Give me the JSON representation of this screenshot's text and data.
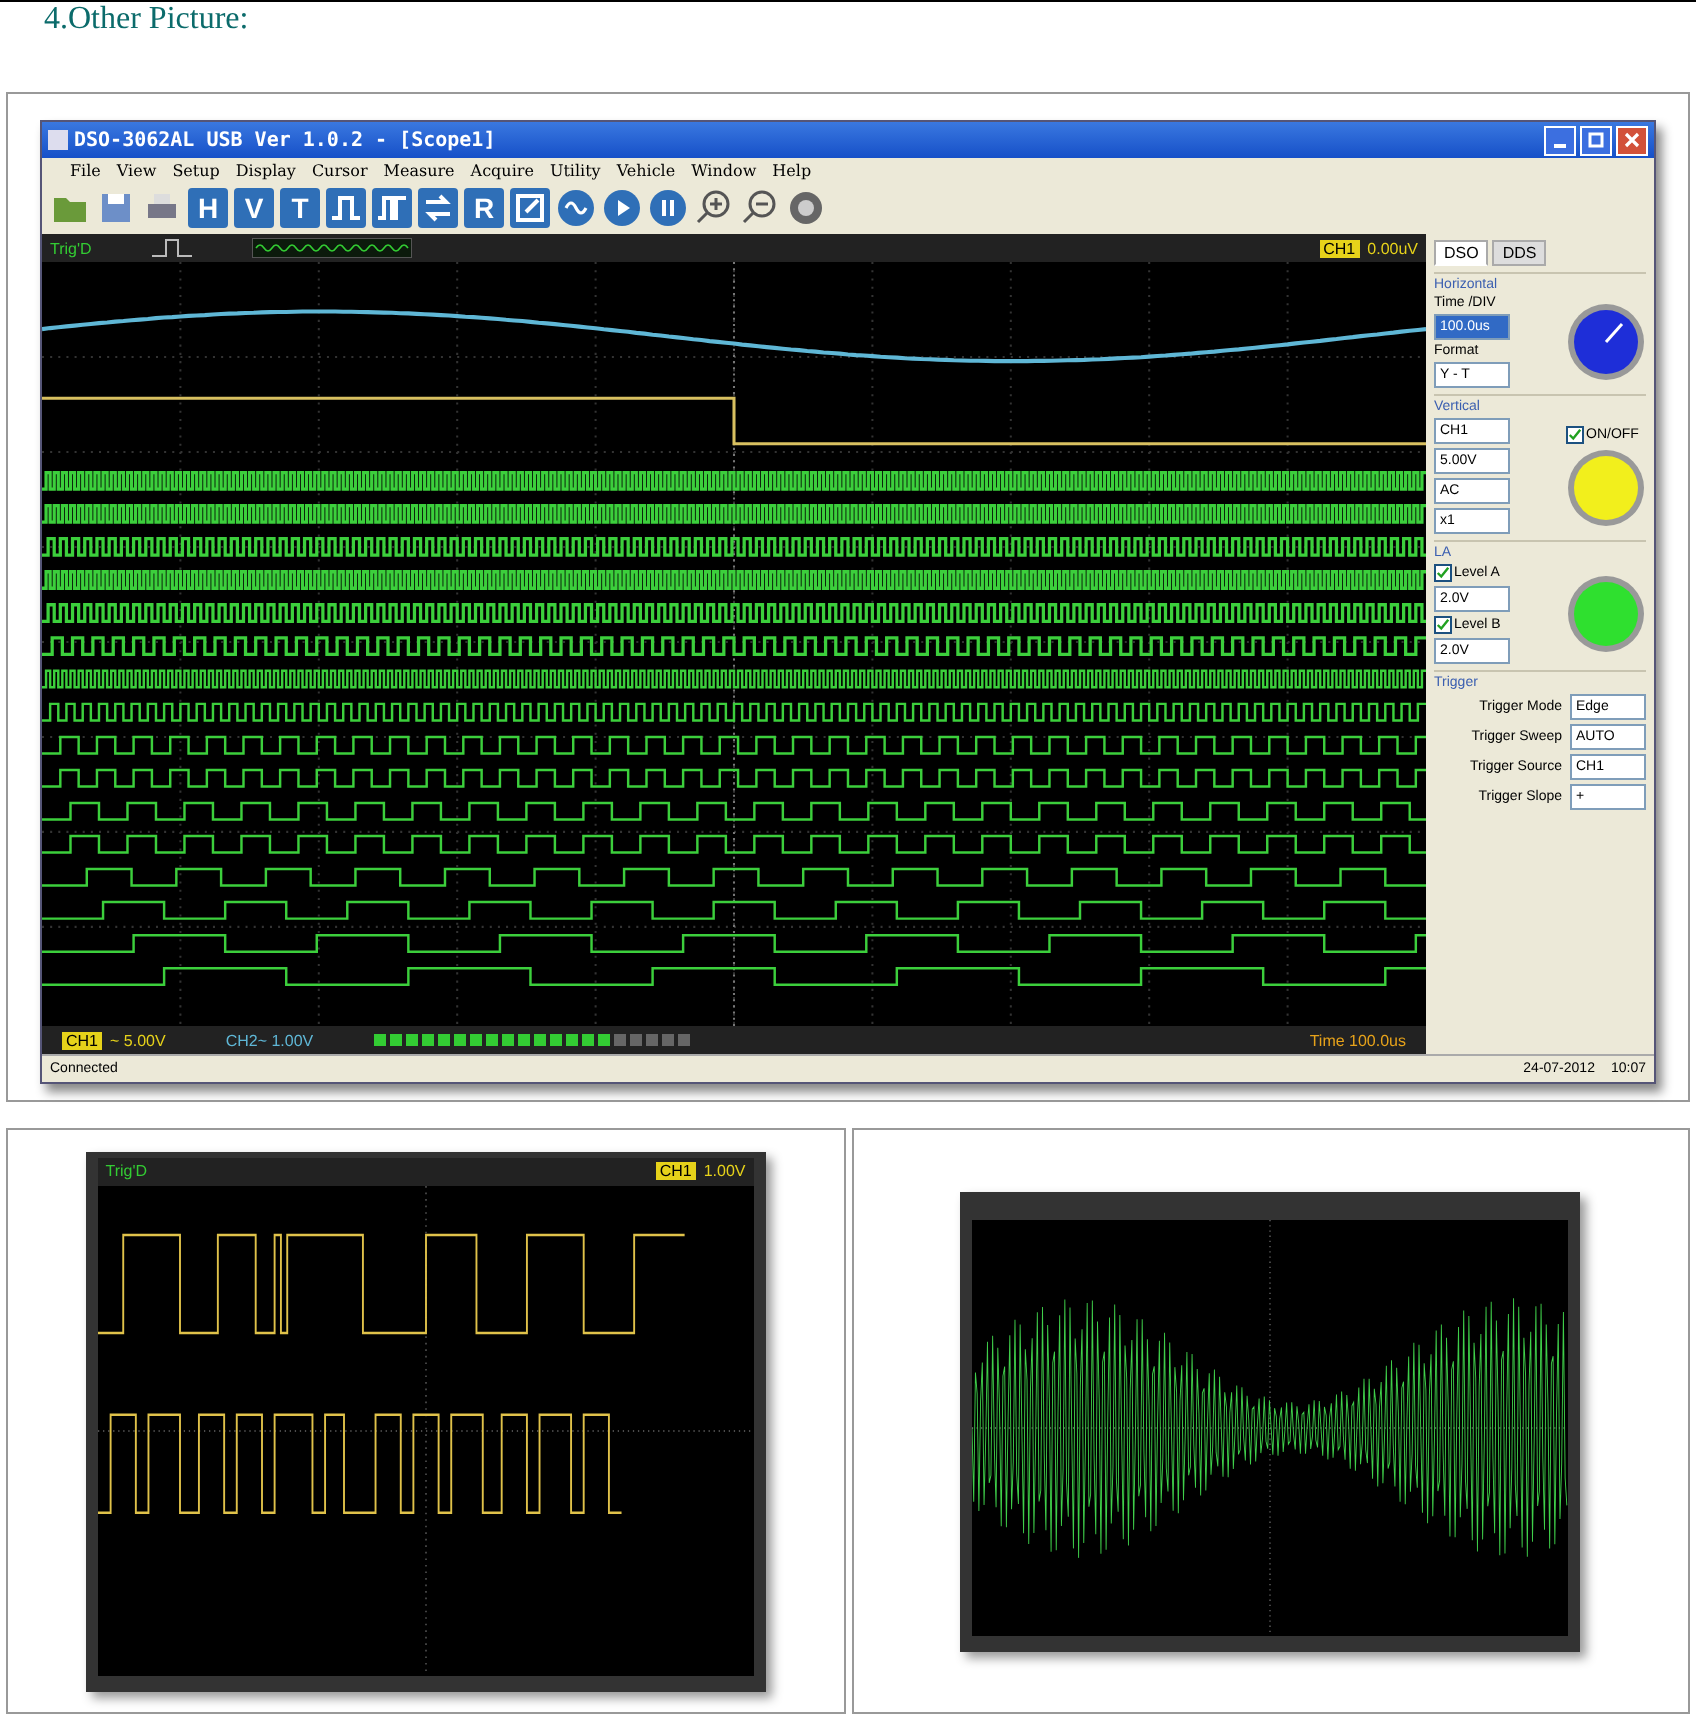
{
  "heading": "4.Other Picture:",
  "main_window": {
    "title": "DSO-3062AL USB Ver 1.0.2 - [Scope1]",
    "menu": [
      "File",
      "View",
      "Setup",
      "Display",
      "Cursor",
      "Measure",
      "Acquire",
      "Utility",
      "Vehicle",
      "Window",
      "Help"
    ],
    "toolbar_letters": [
      "H",
      "V",
      "T",
      "R"
    ],
    "scope": {
      "trigger_status": "Trig'D",
      "channel_badge": "CH1",
      "trigger_level": "0.00uV",
      "ch1_badge": "CH1",
      "ch1_scale": "~ 5.00V",
      "ch2_scale": "CH2~ 1.00V",
      "timebase": "Time 100.0us"
    },
    "tabs": [
      {
        "label": "DSO",
        "selected": true
      },
      {
        "label": "DDS",
        "selected": false
      }
    ],
    "horizontal": {
      "title": "Horizontal",
      "time_label": "Time /DIV",
      "time_value": "100.0us",
      "format_label": "Format",
      "format_value": "Y - T"
    },
    "vertical": {
      "title": "Vertical",
      "channel": "CH1",
      "onoff": {
        "label": "ON/OFF",
        "checked": true
      },
      "volts": "5.00V",
      "coupling": "AC",
      "probe": "x1"
    },
    "la": {
      "title": "LA",
      "levels": [
        {
          "label": "Level A",
          "checked": true,
          "value": "2.0V"
        },
        {
          "label": "Level B",
          "checked": true,
          "value": "2.0V"
        }
      ]
    },
    "trigger": {
      "title": "Trigger",
      "rows": [
        {
          "label": "Trigger Mode",
          "value": "Edge"
        },
        {
          "label": "Trigger Sweep",
          "value": "AUTO"
        },
        {
          "label": "Trigger Source",
          "value": "CH1"
        },
        {
          "label": "Trigger Slope",
          "value": "+"
        }
      ]
    },
    "status_bar": {
      "connection": "Connected",
      "date": "24-07-2012",
      "time": "10:07"
    }
  },
  "small_scope": {
    "trigger_status": "Trig'D",
    "channel_badge": "CH1",
    "level": "1.00V"
  }
}
